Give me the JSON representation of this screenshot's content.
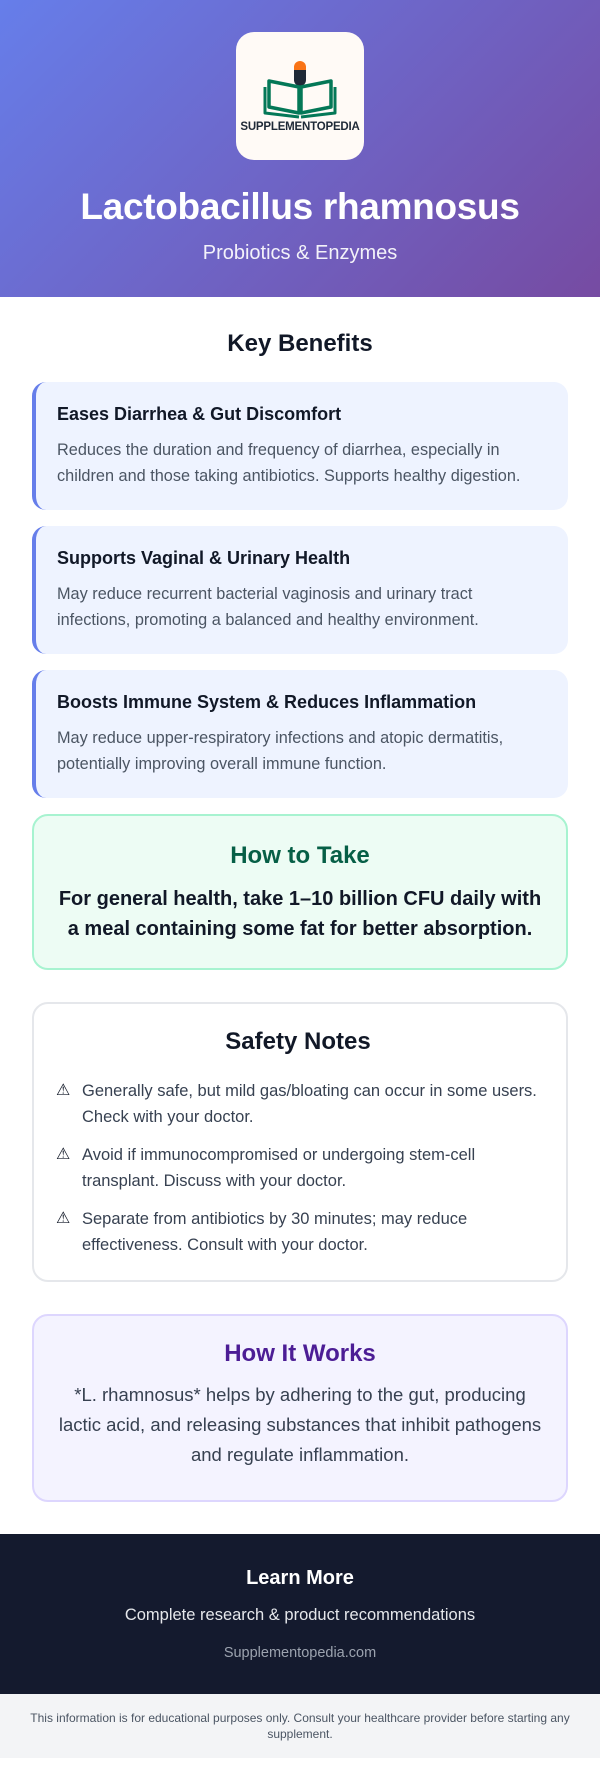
{
  "header": {
    "logo_text": "SUPPLEMENTOPEDIA",
    "title": "Lactobacillus rhamnosus",
    "subtitle": "Probiotics & Enzymes"
  },
  "benefits": {
    "title": "Key Benefits",
    "items": [
      {
        "title": "Eases Diarrhea & Gut Discomfort",
        "text": "Reduces the duration and frequency of diarrhea, especially in children and those taking antibiotics. Supports healthy digestion."
      },
      {
        "title": "Supports Vaginal & Urinary Health",
        "text": "May reduce recurrent bacterial vaginosis and urinary tract infections, promoting a balanced and healthy environment."
      },
      {
        "title": "Boosts Immune System & Reduces Inflammation",
        "text": "May reduce upper-respiratory infections and atopic dermatitis, potentially improving overall immune function."
      }
    ]
  },
  "how_to_take": {
    "title": "How to Take",
    "text": "For general health, take 1–10 billion CFU daily with a meal containing some fat for better absorption."
  },
  "safety": {
    "title": "Safety Notes",
    "icon": "⚠",
    "notes": [
      "Generally safe, but mild gas/bloating can occur in some users. Check with your doctor.",
      "Avoid if immunocompromised or undergoing stem-cell transplant. Discuss with your doctor.",
      "Separate from antibiotics by 30 minutes; may reduce effectiveness. Consult with your doctor."
    ]
  },
  "how_it_works": {
    "title": "How It Works",
    "text": "*L. rhamnosus* helps by adhering to the gut, producing lactic acid, and releasing substances that inhibit pathogens and regulate inflammation."
  },
  "learn_more": {
    "title": "Learn More",
    "subtitle": "Complete research & product recommendations",
    "link": "Supplementopedia.com"
  },
  "disclaimer": "This information is for educational purposes only. Consult your healthcare provider before starting any supplement.",
  "colors": {
    "gradient_start": "#667eea",
    "gradient_end": "#764ba2",
    "benefit_accent": "#667eea",
    "howto_title": "#065f46",
    "works_title": "#4c1d95",
    "footer_bg": "#141a2e"
  }
}
